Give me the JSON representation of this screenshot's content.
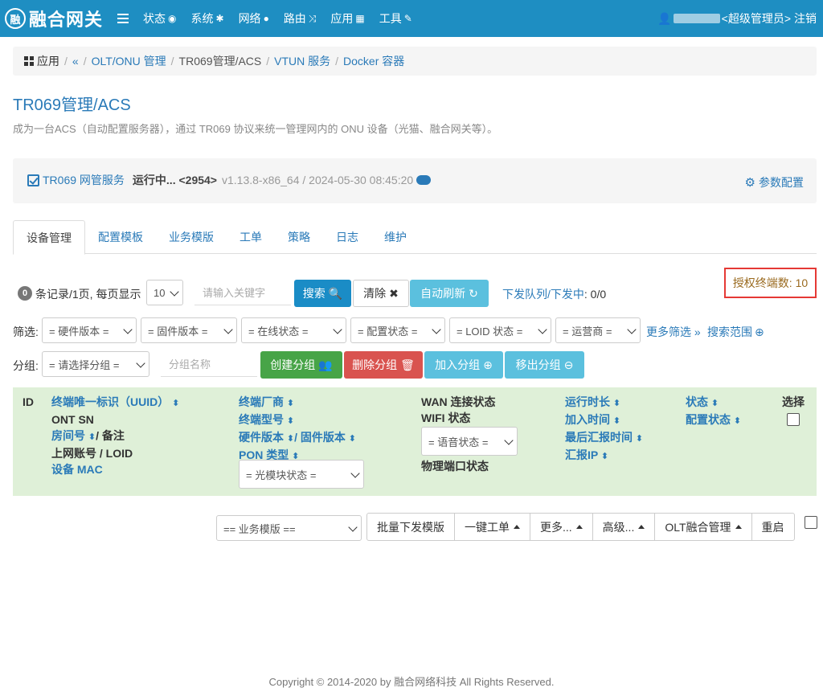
{
  "nav": {
    "brand_logo": "融",
    "brand": "融合网关",
    "items": [
      {
        "label": "状态",
        "icon": "eye-icon"
      },
      {
        "label": "系统",
        "icon": "gear-icon"
      },
      {
        "label": "网络",
        "icon": "globe-icon"
      },
      {
        "label": "路由",
        "icon": "shuffle-icon"
      },
      {
        "label": "应用",
        "icon": "grid-icon"
      },
      {
        "label": "工具",
        "icon": "wrench-icon"
      }
    ],
    "user_role": "<超级管理员>",
    "logout": "注销"
  },
  "breadcrumb": {
    "apps": "应用",
    "back": "«",
    "items": [
      "OLT/ONU 管理",
      "TR069管理/ACS",
      "VTUN 服务",
      "Docker 容器"
    ]
  },
  "page": {
    "title": "TR069管理/ACS",
    "description": "成为一台ACS（自动配置服务器），通过 TR069 协议来统一管理网内的 ONU 设备（光猫、融合网关等）。"
  },
  "service": {
    "name": "TR069 网管服务",
    "status": "运行中... <2954>",
    "version": "v1.13.8-x86_64 / 2024-05-30 08:45:20",
    "config_label": "参数配置"
  },
  "tabs": [
    "设备管理",
    "配置模板",
    "业务模版",
    "工单",
    "策略",
    "日志",
    "维护"
  ],
  "toolbar": {
    "count": "0",
    "count_text": "条记录/1页, 每页显示",
    "page_size": "10",
    "search_placeholder": "请输入关键字",
    "search_btn": "搜索",
    "clear_btn": "清除",
    "auto_refresh_btn": "自动刷新",
    "queue_label": "下发队列/下发中",
    "queue_value": ": 0/0",
    "license": "授权终端数: 10"
  },
  "filters": {
    "label": "筛选:",
    "items": [
      "= 硬件版本 =",
      "= 固件版本 =",
      "= 在线状态 =",
      "= 配置状态 =",
      "= LOID 状态 =",
      "= 运营商 ="
    ],
    "more": "更多筛选 »",
    "scope": "搜索范围"
  },
  "group": {
    "label": "分组:",
    "select": "= 请选择分组 =",
    "name_placeholder": "分组名称",
    "create": "创建分组",
    "delete": "删除分组",
    "join": "加入分组",
    "leave": "移出分组"
  },
  "table": {
    "id": "ID",
    "uuid": "终端唯一标识（UUID）",
    "ont_sn": "ONT SN",
    "room": "房间号",
    "remark": "/ 备注",
    "account": "上网账号 / LOID",
    "mac": "设备 MAC",
    "vendor": "终端厂商",
    "model": "终端型号",
    "hw": "硬件版本",
    "fw": "/ 固件版本",
    "pon": "PON 类型",
    "optic_select": "= 光模块状态 =",
    "wan": "WAN 连接状态",
    "wifi": "WIFI 状态",
    "voice_select": "= 语音状态 =",
    "port": "物理端口状态",
    "uptime": "运行时长",
    "join_time": "加入时间",
    "last_report": "最后汇报时间",
    "report_ip": "汇报IP",
    "state": "状态",
    "config_state": "配置状态",
    "select": "选择"
  },
  "bottom": {
    "template_select": "== 业务模版 ==",
    "buttons": [
      "批量下发模版",
      "一键工单",
      "更多...",
      "高级...",
      "OLT融合管理",
      "重启"
    ]
  },
  "footer": "Copyright © 2014-2020 by 融合网络科技 All Rights Reserved."
}
